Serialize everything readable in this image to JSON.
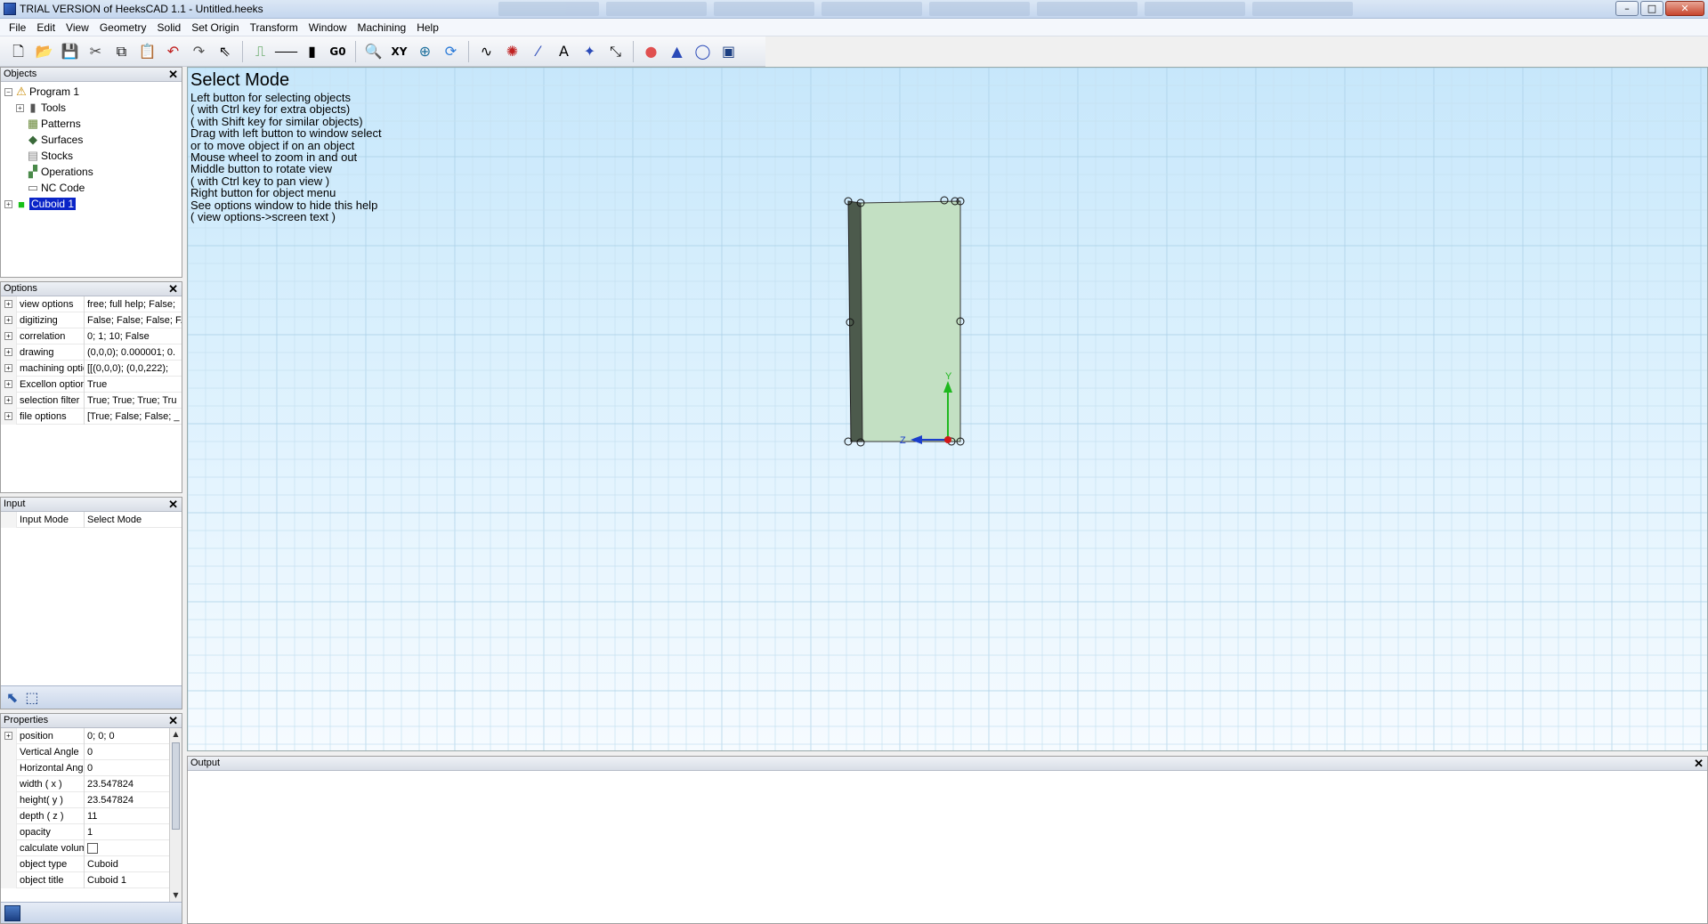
{
  "window": {
    "title": "TRIAL VERSION of HeeksCAD 1.1 - Untitled.heeks",
    "minimize_glyph": "–",
    "maximize_glyph": "□",
    "close_glyph": "✕"
  },
  "menu": [
    "File",
    "Edit",
    "View",
    "Geometry",
    "Solid",
    "Set Origin",
    "Transform",
    "Window",
    "Machining",
    "Help"
  ],
  "toolbar": {
    "icons": [
      {
        "name": "new-file-icon",
        "glyph": "🗋"
      },
      {
        "name": "open-folder-icon",
        "glyph": "📂"
      },
      {
        "name": "save-icon",
        "glyph": "💾"
      },
      {
        "name": "cut-icon",
        "glyph": "✂"
      },
      {
        "name": "copy-icon",
        "glyph": "⧉"
      },
      {
        "name": "paste-icon",
        "glyph": "📋"
      },
      {
        "name": "undo-icon",
        "glyph": "↶"
      },
      {
        "name": "redo-icon",
        "glyph": "↷"
      },
      {
        "name": "select-arrow-icon",
        "glyph": "⇖"
      },
      {
        "name": "sep"
      },
      {
        "name": "profile-op-icon",
        "glyph": "⎍"
      },
      {
        "name": "pocket-op-icon",
        "glyph": "⸺"
      },
      {
        "name": "drill-op-icon",
        "glyph": "▮"
      },
      {
        "name": "g0-icon",
        "glyph": "G0"
      },
      {
        "name": "sep"
      },
      {
        "name": "zoom-window-icon",
        "glyph": "🔍"
      },
      {
        "name": "view-xy-icon",
        "glyph": "XY"
      },
      {
        "name": "fit-view-icon",
        "glyph": "⊕"
      },
      {
        "name": "redraw-icon",
        "glyph": "⟳"
      },
      {
        "name": "sep"
      },
      {
        "name": "spline-icon",
        "glyph": "∿"
      },
      {
        "name": "circles-icon",
        "glyph": "✺"
      },
      {
        "name": "line-icon",
        "glyph": "⁄"
      },
      {
        "name": "text-icon",
        "glyph": "A"
      },
      {
        "name": "coordinate-system-icon",
        "glyph": "✦"
      },
      {
        "name": "dimension-icon",
        "glyph": "⤡"
      },
      {
        "name": "sep"
      },
      {
        "name": "sphere-icon",
        "glyph": "●"
      },
      {
        "name": "cone-icon",
        "glyph": "▲"
      },
      {
        "name": "cylinder-icon",
        "glyph": "◯"
      },
      {
        "name": "cuboid-icon",
        "glyph": "▣"
      }
    ]
  },
  "objects_panel": {
    "title": "Objects",
    "items": [
      {
        "label": "Program 1",
        "level": 0,
        "expander": "−",
        "icon": "program-icon",
        "glyph": "⚠",
        "color": "#c88a00"
      },
      {
        "label": "Tools",
        "level": 1,
        "expander": "+",
        "icon": "tools-icon",
        "glyph": "▮",
        "color": "#555555"
      },
      {
        "label": "Patterns",
        "level": 1,
        "expander": "",
        "icon": "patterns-icon",
        "glyph": "▦",
        "color": "#6a8a3a"
      },
      {
        "label": "Surfaces",
        "level": 1,
        "expander": "",
        "icon": "surfaces-icon",
        "glyph": "◆",
        "color": "#3a6a3a"
      },
      {
        "label": "Stocks",
        "level": 1,
        "expander": "",
        "icon": "stocks-icon",
        "glyph": "▤",
        "color": "#888888"
      },
      {
        "label": "Operations",
        "level": 1,
        "expander": "",
        "icon": "operations-icon",
        "glyph": "▞",
        "color": "#4a8a4a"
      },
      {
        "label": "NC Code",
        "level": 1,
        "expander": "",
        "icon": "nc-code-icon",
        "glyph": "▭",
        "color": "#666666"
      },
      {
        "label": "Cuboid 1",
        "level": 0,
        "expander": "+",
        "icon": "cuboid-tree-icon",
        "glyph": "■",
        "color": "#18c018",
        "selected": true
      }
    ]
  },
  "options_panel": {
    "title": "Options",
    "rows": [
      {
        "name": "view options",
        "value": "free; full help; False;"
      },
      {
        "name": "digitizing",
        "value": "False; False; False; F."
      },
      {
        "name": "correlation",
        "value": "0; 1; 10; False"
      },
      {
        "name": "drawing",
        "value": "(0,0,0); 0.000001; 0."
      },
      {
        "name": "machining optic",
        "value": "[[(0,0,0); (0,0,222);"
      },
      {
        "name": "Excellon option",
        "value": "True"
      },
      {
        "name": "selection filter",
        "value": "True; True; True; Tru"
      },
      {
        "name": "file options",
        "value": "[True; False; False; _"
      }
    ]
  },
  "input_panel": {
    "title": "Input",
    "rows": [
      {
        "name": "Input Mode",
        "value": "Select Mode"
      }
    ]
  },
  "properties_panel": {
    "title": "Properties",
    "rows": [
      {
        "name": "position",
        "value": "0; 0; 0",
        "expandable": true
      },
      {
        "name": "Vertical Angle",
        "value": "0"
      },
      {
        "name": "Horizontal Angl",
        "value": "0"
      },
      {
        "name": "width ( x )",
        "value": "23.547824"
      },
      {
        "name": "height( y )",
        "value": "23.547824"
      },
      {
        "name": "depth ( z )",
        "value": "11"
      },
      {
        "name": "opacity",
        "value": "1"
      },
      {
        "name": "calculate volum",
        "value": "",
        "checkbox": true
      },
      {
        "name": "object type",
        "value": "Cuboid"
      },
      {
        "name": "object title",
        "value": "Cuboid 1"
      }
    ]
  },
  "viewport": {
    "help_title": "Select Mode",
    "help_lines": [
      "Left button for selecting objects",
      "( with Ctrl key for extra objects)",
      "( with Shift key for similar objects)",
      "Drag with left button to window select",
      "or to move object if on an object",
      "Mouse wheel to zoom in and out",
      "Middle button to rotate view",
      "( with Ctrl key to pan view )",
      "Right button for object menu",
      "See options window to hide this help",
      "( view options->screen text )"
    ],
    "axis_y": "Y",
    "axis_z": "Z"
  },
  "output_panel": {
    "title": "Output"
  },
  "colors": {
    "cuboid_face": "#c3e0c3",
    "cuboid_side": "#4c5a4c",
    "selection": "#0a24c8"
  }
}
